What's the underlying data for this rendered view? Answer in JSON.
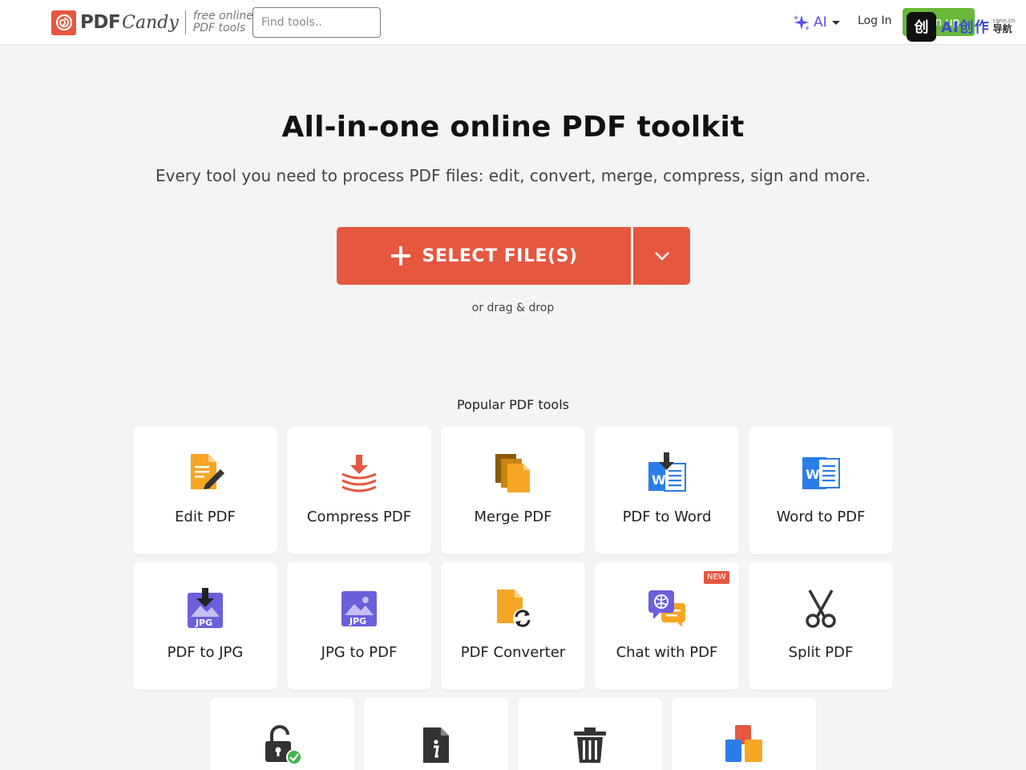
{
  "header": {
    "brand_pdf": "PDF",
    "brand_candy": "Candy",
    "tagline_1": "free online",
    "tagline_2": "PDF tools",
    "search_placeholder": "Find tools..",
    "ai_label": "AI",
    "login_label": "Log In",
    "signup_label": "Sign up"
  },
  "overlay": {
    "icon_glyph": "创",
    "text": "AI创作",
    "sub": "cgnn.cn",
    "nav": "导航"
  },
  "hero": {
    "title": "All-in-one online PDF toolkit",
    "subtitle": "Every tool you need to process PDF files: edit, convert, merge, compress, sign and more.",
    "select_label": "SELECT FILE(S)",
    "drag_label": "or drag & drop"
  },
  "tools": {
    "heading": "Popular PDF tools",
    "items": [
      {
        "label": "Edit PDF",
        "icon": "edit-pdf-icon"
      },
      {
        "label": "Compress PDF",
        "icon": "compress-pdf-icon"
      },
      {
        "label": "Merge PDF",
        "icon": "merge-pdf-icon"
      },
      {
        "label": "PDF to Word",
        "icon": "pdf-to-word-icon"
      },
      {
        "label": "Word to PDF",
        "icon": "word-to-pdf-icon"
      },
      {
        "label": "PDF to JPG",
        "icon": "pdf-to-jpg-icon"
      },
      {
        "label": "JPG to PDF",
        "icon": "jpg-to-pdf-icon"
      },
      {
        "label": "PDF Converter",
        "icon": "pdf-converter-icon"
      },
      {
        "label": "Chat with PDF",
        "icon": "chat-with-pdf-icon",
        "badge": "NEW"
      },
      {
        "label": "Split PDF",
        "icon": "scissors-icon"
      },
      {
        "label": "",
        "icon": "unlock-pdf-icon"
      },
      {
        "label": "",
        "icon": "pdf-info-icon"
      },
      {
        "label": "",
        "icon": "delete-pages-icon"
      },
      {
        "label": "",
        "icon": "organize-pdf-icon"
      }
    ]
  },
  "colors": {
    "brand_red": "#e5573f",
    "signup_green": "#6ab83a",
    "ai_purple": "#5a4ff0"
  }
}
